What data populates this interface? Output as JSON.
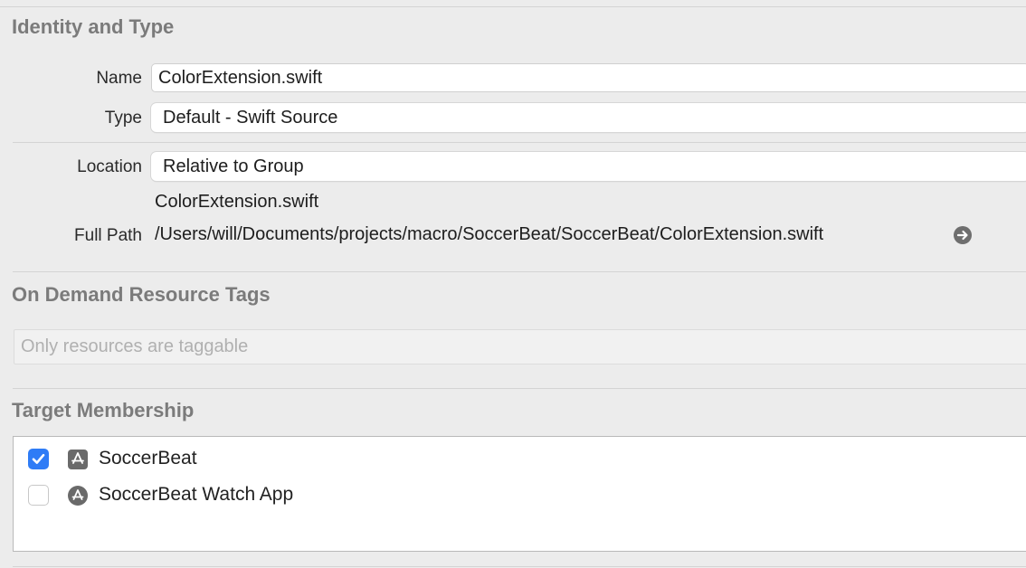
{
  "identity": {
    "title": "Identity and Type",
    "name_label": "Name",
    "name_value": "ColorExtension.swift",
    "type_label": "Type",
    "type_value": "Default - Swift Source",
    "location_label": "Location",
    "location_value": "Relative to Group",
    "relative_filename": "ColorExtension.swift",
    "full_path_label": "Full Path",
    "full_path_value": "/Users/will/Documents/projects/macro/SoccerBeat/SoccerBeat/ColorExtension.swift",
    "reveal_icon": "arrow-right-circle-icon"
  },
  "on_demand": {
    "title": "On Demand Resource Tags",
    "placeholder": "Only resources are taggable"
  },
  "target_membership": {
    "title": "Target Membership",
    "targets": [
      {
        "label": "SoccerBeat",
        "checked": true,
        "icon": "app-store-icon"
      },
      {
        "label": "SoccerBeat Watch App",
        "checked": false,
        "icon": "watch-app-icon"
      }
    ]
  },
  "colors": {
    "background": "#ececec",
    "section_title": "#7b7b7b",
    "accent": "#2f7cf6"
  }
}
